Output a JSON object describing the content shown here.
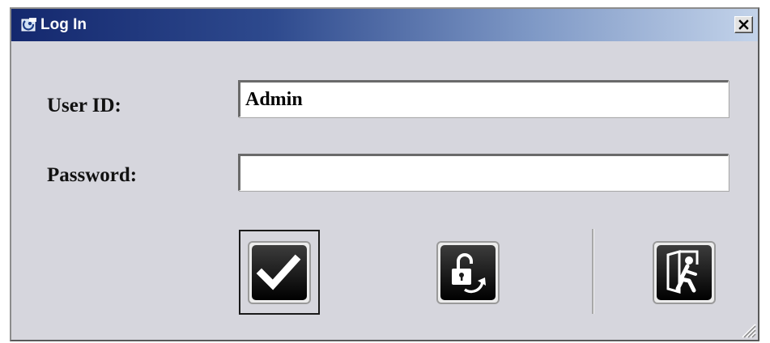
{
  "window": {
    "title": "Log In",
    "app_icon": "log-in-app-icon",
    "close_icon": "close-x-icon"
  },
  "form": {
    "user_id_label": "User ID:",
    "user_id_value": "Admin",
    "password_label": "Password:",
    "password_value": ""
  },
  "buttons": {
    "ok_icon": "checkmark-icon",
    "change_password_icon": "unlock-refresh-icon",
    "exit_icon": "exit-door-icon"
  },
  "colors": {
    "title_gradient_start": "#14286e",
    "title_gradient_end": "#c3d3ea",
    "window_background": "#d6d6dd",
    "button_face": "#1b1b1b"
  }
}
